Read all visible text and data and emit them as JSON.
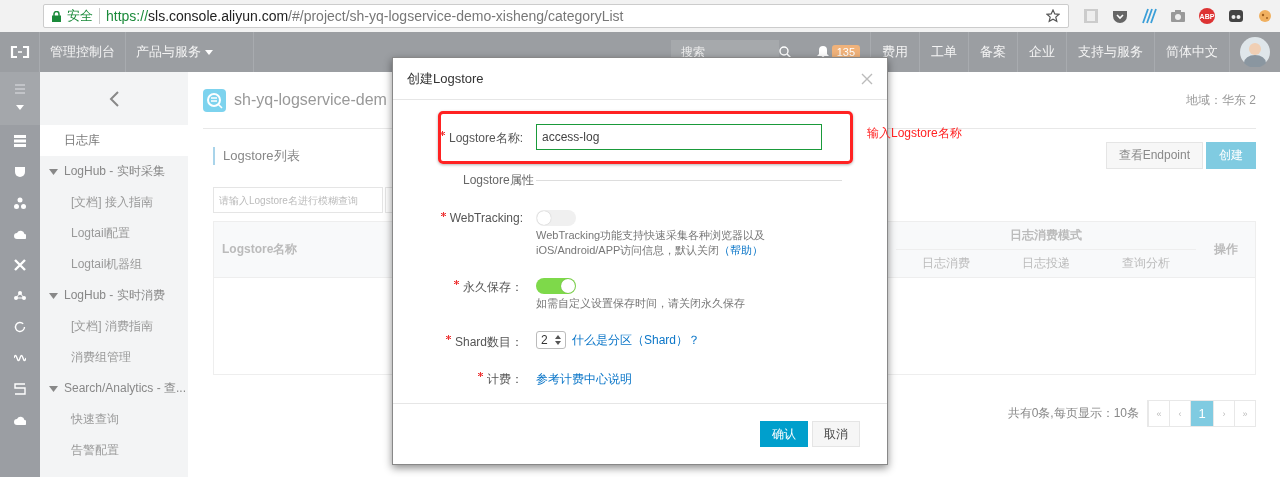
{
  "browser": {
    "security_label": "安全",
    "url": {
      "scheme": "https://",
      "host": "sls.console.aliyun.com",
      "path": "/#/project/sh-yq-logservice-demo-xisheng/categoryList"
    },
    "abp_label": "ABP"
  },
  "topbar": {
    "console_label": "管理控制台",
    "products_label": "产品与服务",
    "search": {
      "placeholder": "搜索"
    },
    "notification_count": "135",
    "links": [
      "费用",
      "工单",
      "备案",
      "企业",
      "支持与服务",
      "简体中文"
    ]
  },
  "sidebar": {
    "items": [
      {
        "label": "日志库",
        "selected": true
      },
      {
        "label": "LogHub - 实时采集",
        "expanded": true,
        "children": [
          {
            "label": "[文档] 接入指南",
            "selected": false
          },
          {
            "label": "Logtail配置",
            "selected": false
          },
          {
            "label": "Logtail机器组",
            "selected": false
          }
        ]
      },
      {
        "label": "LogHub - 实时消费",
        "expanded": true,
        "children": [
          {
            "label": "[文档] 消费指南",
            "selected": false
          },
          {
            "label": "消费组管理",
            "selected": false
          }
        ]
      },
      {
        "label": "Search/Analytics - 查...",
        "expanded": true,
        "children": [
          {
            "label": "快速查询",
            "selected": false
          },
          {
            "label": "告警配置",
            "selected": false
          }
        ]
      }
    ]
  },
  "page": {
    "project_name": "sh-yq-logservice-dem",
    "region": "地域：华东 2",
    "list_title": "Logstore列表",
    "search": {
      "placeholder": "请输入Logstore名进行模糊查询"
    },
    "buttons": [
      {
        "label": "查看Endpoint",
        "kind": "default"
      },
      {
        "label": "创建",
        "kind": "primary"
      }
    ],
    "table": {
      "name_column": "Logstore名称",
      "group_column": "日志消费模式",
      "sub_columns": [
        "日志消费",
        "日志投递",
        "查询分析"
      ],
      "action_column": "操作"
    },
    "footer": "共有0条,每页显示：10条",
    "pagination": [
      {
        "label": "«",
        "selected": false
      },
      {
        "label": "‹",
        "selected": false
      },
      {
        "label": "1",
        "selected": true
      },
      {
        "label": "›",
        "selected": false
      },
      {
        "label": "»",
        "selected": false
      }
    ]
  },
  "dialog": {
    "title": "创建Logstore",
    "fields": [
      {
        "kind": "text",
        "label": "Logstore名称:",
        "required": true,
        "value": "access-log",
        "highlight_note": "输入Logstore名称"
      },
      {
        "kind": "section",
        "label": "Logstore属性"
      },
      {
        "kind": "toggle",
        "label": "WebTracking:",
        "required": true,
        "on": false,
        "help": "WebTracking功能支持快速采集各种浏览器以及iOS/Android/APP访问信息，默认关闭",
        "help_link": "（帮助）"
      },
      {
        "kind": "toggle",
        "label": "永久保存：",
        "required": true,
        "on": true,
        "help": "如需自定义设置保存时间，请关闭永久保存"
      },
      {
        "kind": "number",
        "label": "Shard数目：",
        "required": true,
        "value": "2",
        "link": "什么是分区（Shard）？"
      },
      {
        "kind": "link",
        "label": "计费：",
        "required": true,
        "link": "参考计费中心说明"
      }
    ],
    "buttons": [
      {
        "label": "确认",
        "kind": "primary"
      },
      {
        "label": "取消",
        "kind": "default"
      }
    ]
  }
}
